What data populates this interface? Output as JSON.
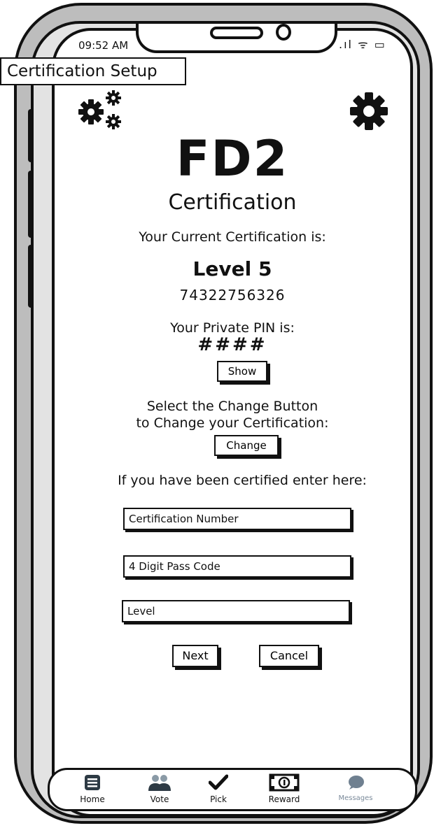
{
  "status_bar": {
    "time": "09:52 AM",
    "icons_text": ".ıl ᯤ ▭"
  },
  "page_label": "Certification Setup",
  "header": {
    "brand": "FD2",
    "subtitle": "Certification"
  },
  "certification": {
    "current_label": "Your Current Certification is:",
    "level": "Level 5",
    "number": "74322756326",
    "pin_label": "Your Private PIN is:",
    "pin_masked": "####",
    "show_button": "Show",
    "change_instructions_line1": "Select the Change Button",
    "change_instructions_line2": "to Change your Certification:",
    "change_button": "Change"
  },
  "form": {
    "prompt": "If you have been certified enter here:",
    "cert_number_placeholder": "Certification Number",
    "pass_code_placeholder": "4 Digit Pass Code",
    "level_placeholder": "Level",
    "next_button": "Next",
    "cancel_button": "Cancel"
  },
  "tabs": [
    {
      "label": "Home",
      "icon": "home-list-icon"
    },
    {
      "label": "Vote",
      "icon": "people-icon"
    },
    {
      "label": "Pick",
      "icon": "checkmark-icon"
    },
    {
      "label": "Reward",
      "icon": "dollar-bill-icon"
    },
    {
      "label": "Messages",
      "icon": "chat-bubble-icon"
    }
  ],
  "colors": {
    "ink": "#111111",
    "frame_gray": "#bdbdbd",
    "muted_tab": "#7a8a9a"
  }
}
